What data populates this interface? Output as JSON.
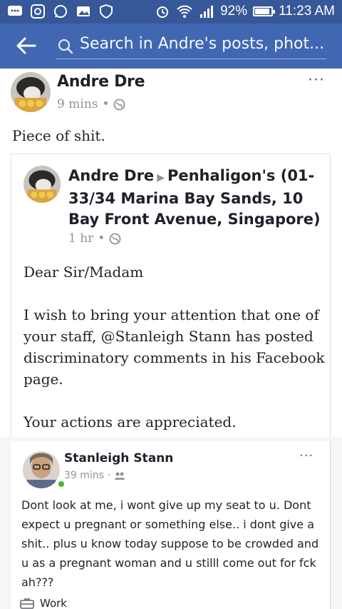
{
  "status_bar": {
    "battery_percent": "92%",
    "battery_level": 0.92,
    "time": "11:23 AM",
    "left_icons": [
      "chat-icon",
      "instagram-icon",
      "whatsapp-icon",
      "photos-icon",
      "shield-icon"
    ],
    "right_icons": [
      "alarm-icon",
      "wifi-icon",
      "signal-icon",
      "battery-icon"
    ]
  },
  "app_bar": {
    "search_placeholder": "Search in Andre's posts, phot..."
  },
  "post": {
    "author": "Andre Dre",
    "time": "9 mins",
    "privacy_icon": "globe-icon",
    "text": "Piece of shit.",
    "shared": {
      "author": "Andre Dre",
      "target": "Penhaligon's (01-33/34 Marina Bay Sands, 10 Bay Front Avenue, Singapore)",
      "time": "1 hr",
      "paragraphs": [
        "Dear Sir/Madam",
        "I wish to bring your attention that one of your staff, @Stanleigh Stann has posted discriminatory comments in his Facebook page.",
        "Your actions are appreciated."
      ]
    }
  },
  "screenshot_post": {
    "author": "Stanleigh Stann",
    "time": "39 mins",
    "audience_icon": "friends-icon",
    "text": "Dont look at me, i wont give up my seat to u. Dont expect u pregnant or something else.. i dont give a shit.. plus u know today suppose to be crowded and u as a pregnant woman and u stilll come out for fck ah???",
    "work_label": "Work"
  }
}
